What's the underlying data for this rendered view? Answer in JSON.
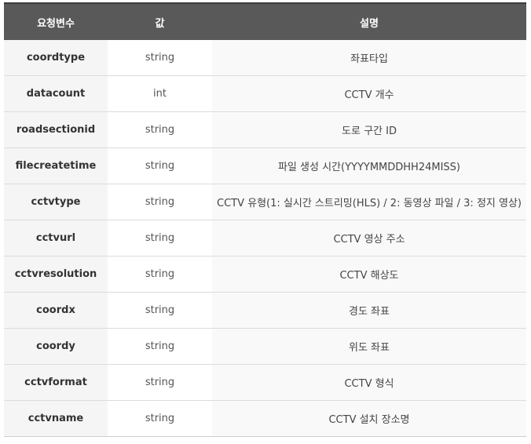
{
  "table": {
    "headers": [
      "요청변수",
      "값",
      "설명"
    ],
    "rows": [
      {
        "param": "coordtype",
        "value": "string",
        "desc": "좌표타입"
      },
      {
        "param": "datacount",
        "value": "int",
        "desc": "CCTV 개수"
      },
      {
        "param": "roadsectionid",
        "value": "string",
        "desc": "도로 구간 ID"
      },
      {
        "param": "filecreatetime",
        "value": "string",
        "desc": "파일 생성 시간(YYYYMMDDHH24MISS)"
      },
      {
        "param": "cctvtype",
        "value": "string",
        "desc": "CCTV 유형(1: 실시간 스트리밍(HLS) / 2: 동영상 파일 / 3: 정지 영상)"
      },
      {
        "param": "cctvurl",
        "value": "string",
        "desc": "CCTV 영상 주소"
      },
      {
        "param": "cctvresolution",
        "value": "string",
        "desc": "CCTV 해상도"
      },
      {
        "param": "coordx",
        "value": "string",
        "desc": "경도 좌표"
      },
      {
        "param": "coordy",
        "value": "string",
        "desc": "위도 좌표"
      },
      {
        "param": "cctvformat",
        "value": "string",
        "desc": "CCTV 형식"
      },
      {
        "param": "cctvname",
        "value": "string",
        "desc": "CCTV 설치 장소명"
      }
    ]
  },
  "colors": {
    "header_bg": "#595959",
    "header_text": "#ffffff",
    "param_bg": "#f5f5f5",
    "border": "#dcdcdc"
  }
}
